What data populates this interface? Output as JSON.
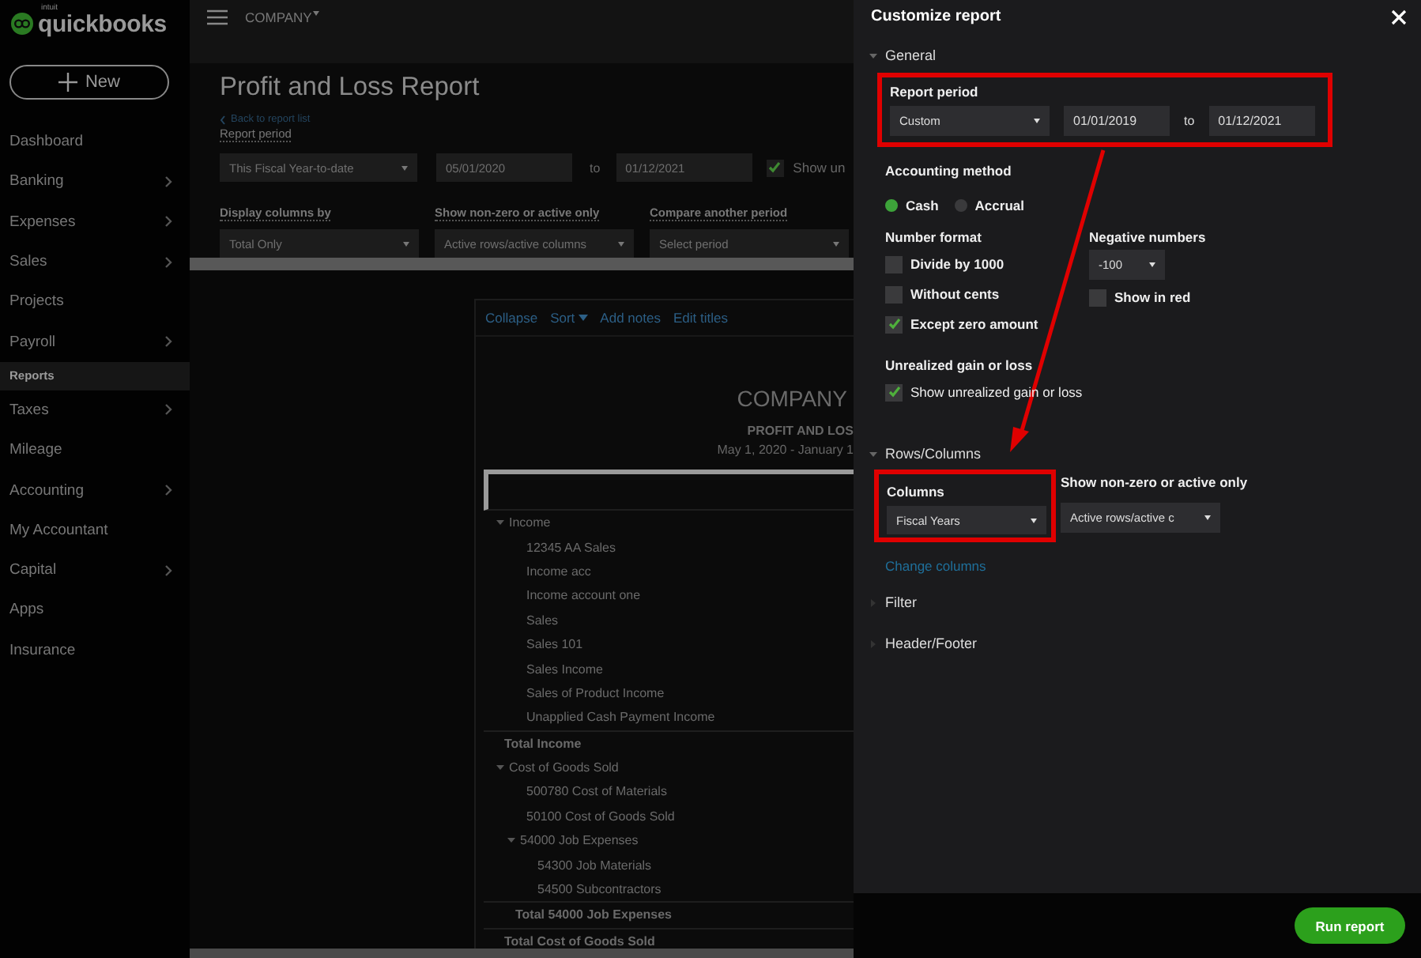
{
  "app": {
    "brand_small": "intuit",
    "brand": "quickbooks",
    "company": "COMPANY",
    "new_button": "New"
  },
  "sidebar": [
    {
      "label": "Dashboard",
      "submenu": false,
      "selected": false
    },
    {
      "label": "Banking",
      "submenu": true,
      "selected": false
    },
    {
      "label": "Expenses",
      "submenu": true,
      "selected": false
    },
    {
      "label": "Sales",
      "submenu": true,
      "selected": false
    },
    {
      "label": "Projects",
      "submenu": false,
      "selected": false
    },
    {
      "label": "Payroll",
      "submenu": true,
      "selected": false
    },
    {
      "label": "Reports",
      "submenu": false,
      "selected": true
    },
    {
      "label": "Taxes",
      "submenu": true,
      "selected": false
    },
    {
      "label": "Mileage",
      "submenu": false,
      "selected": false
    },
    {
      "label": "Accounting",
      "submenu": true,
      "selected": false
    },
    {
      "label": "My Accountant",
      "submenu": false,
      "selected": false
    },
    {
      "label": "Capital",
      "submenu": true,
      "selected": false
    },
    {
      "label": "Apps",
      "submenu": false,
      "selected": false
    },
    {
      "label": "Insurance",
      "submenu": false,
      "selected": false
    }
  ],
  "report_page": {
    "title": "Profit and Loss Report",
    "back_link": "Back to report list",
    "period": {
      "label": "Report period",
      "preset": "This Fiscal Year-to-date",
      "from": "05/01/2020",
      "to_label": "to",
      "to": "01/12/2021",
      "option": {
        "label": "Show un",
        "checked": true
      }
    },
    "options": [
      {
        "label": "Display columns by",
        "value": "Total Only"
      },
      {
        "label": "Show non-zero or active only",
        "value": "Active rows/active columns"
      },
      {
        "label": "Compare another period",
        "value": "Select period"
      }
    ]
  },
  "report": {
    "toolbar": [
      {
        "label": "Collapse",
        "menu": false
      },
      {
        "label": "Sort",
        "menu": true
      },
      {
        "label": "Add notes",
        "menu": false
      },
      {
        "label": "Edit titles",
        "menu": false
      }
    ],
    "company": "COMPANY",
    "title": "PROFIT AND LOS",
    "dates": "May 1, 2020 - January 1",
    "rows": [
      {
        "kind": "group",
        "label": "Income",
        "expanded": true,
        "children": [
          {
            "kind": "account",
            "label": "12345 AA Sales"
          },
          {
            "kind": "account",
            "label": "Income acc"
          },
          {
            "kind": "account",
            "label": "Income account one"
          },
          {
            "kind": "account",
            "label": "Sales"
          },
          {
            "kind": "account",
            "label": "Sales 101"
          },
          {
            "kind": "account",
            "label": "Sales Income"
          },
          {
            "kind": "account",
            "label": "Sales of Product Income"
          },
          {
            "kind": "account",
            "label": "Unapplied Cash Payment Income"
          }
        ]
      },
      {
        "kind": "total",
        "label": "Total Income"
      },
      {
        "kind": "group",
        "label": "Cost of Goods Sold",
        "expanded": true,
        "children": [
          {
            "kind": "account",
            "label": "500780 Cost of Materials"
          },
          {
            "kind": "account",
            "label": "50100 Cost of Goods Sold"
          },
          {
            "kind": "group",
            "label": "54000 Job Expenses",
            "expanded": true,
            "children": [
              {
                "kind": "account",
                "label": "54300 Job Materials"
              },
              {
                "kind": "account",
                "label": "54500 Subcontractors"
              }
            ]
          },
          {
            "kind": "total",
            "label": "Total 54000 Job Expenses"
          }
        ]
      },
      {
        "kind": "total",
        "label": "Total Cost of Goods Sold"
      }
    ]
  },
  "customize": {
    "title": "Customize report",
    "general": {
      "title": "General",
      "expanded": true,
      "report_period": {
        "label": "Report period",
        "preset": "Custom",
        "from": "01/01/2019",
        "to_label": "to",
        "to": "01/12/2021",
        "highlighted": true
      },
      "accounting": {
        "label": "Accounting method",
        "options": [
          {
            "label": "Cash",
            "selected": true
          },
          {
            "label": "Accrual",
            "selected": false
          }
        ]
      },
      "number_format": {
        "label": "Number format",
        "options": [
          {
            "label": "Divide by 1000",
            "checked": false
          },
          {
            "label": "Without cents",
            "checked": false
          },
          {
            "label": "Except zero amount",
            "checked": true
          }
        ]
      },
      "negative_numbers": {
        "label": "Negative numbers",
        "value": "-100",
        "option": {
          "label": "Show in red",
          "checked": false
        }
      },
      "unrealized": {
        "label": "Unrealized gain or loss",
        "option": {
          "label": "Show unrealized gain or loss",
          "checked": true
        }
      }
    },
    "rows_columns": {
      "title": "Rows/Columns",
      "expanded": true,
      "columns": {
        "label": "Columns",
        "value": "Fiscal Years",
        "highlighted": true
      },
      "show_non_zero": {
        "label": "Show non-zero or active only",
        "value": "Active rows/active c"
      },
      "change_link": "Change columns"
    },
    "other_sections": [
      {
        "title": "Filter",
        "expanded": false
      },
      {
        "title": "Header/Footer",
        "expanded": false
      }
    ],
    "run_button": "Run report"
  }
}
